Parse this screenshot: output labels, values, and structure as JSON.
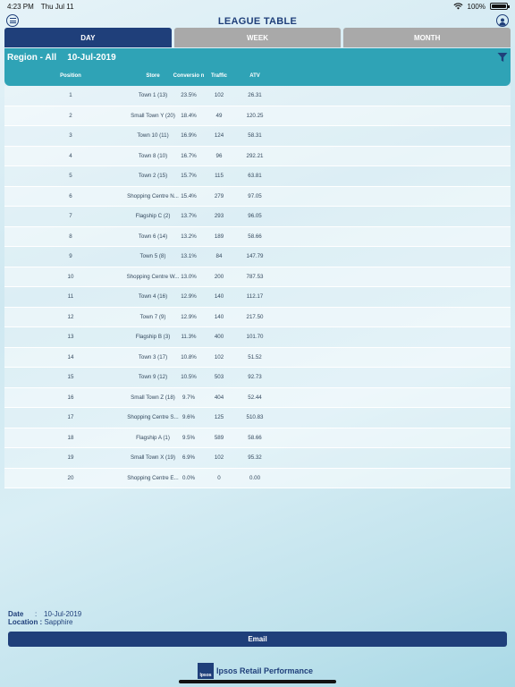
{
  "status_bar": {
    "time": "4:23 PM",
    "date": "Thu Jul 11",
    "battery": "100%",
    "battery_level": 1.0
  },
  "header": {
    "title": "LEAGUE TABLE"
  },
  "tabs": [
    {
      "label": "DAY",
      "active": true
    },
    {
      "label": "WEEK",
      "active": false
    },
    {
      "label": "MONTH",
      "active": false
    }
  ],
  "filter": {
    "region": "Region - All",
    "date": "10-Jul-2019"
  },
  "table": {
    "headers": {
      "position": "Position",
      "store": "Store",
      "conversion": "Conversio n",
      "traffic": "Traffic",
      "atv": "ATV"
    },
    "rows": [
      {
        "position": "1",
        "store": "Town 1 (13)",
        "conversion": "23.5%",
        "traffic": "102",
        "atv": "26.31"
      },
      {
        "position": "2",
        "store": "Small Town Y (20)",
        "conversion": "18.4%",
        "traffic": "49",
        "atv": "120.25"
      },
      {
        "position": "3",
        "store": "Town 10 (11)",
        "conversion": "16.9%",
        "traffic": "124",
        "atv": "58.31"
      },
      {
        "position": "4",
        "store": "Town 8 (10)",
        "conversion": "16.7%",
        "traffic": "96",
        "atv": "292.21"
      },
      {
        "position": "5",
        "store": "Town 2 (15)",
        "conversion": "15.7%",
        "traffic": "115",
        "atv": "63.81"
      },
      {
        "position": "6",
        "store": "Shopping Centre N...",
        "conversion": "15.4%",
        "traffic": "279",
        "atv": "97.05"
      },
      {
        "position": "7",
        "store": "Flagship C (2)",
        "conversion": "13.7%",
        "traffic": "293",
        "atv": "96.05"
      },
      {
        "position": "8",
        "store": "Town 6 (14)",
        "conversion": "13.2%",
        "traffic": "189",
        "atv": "58.66"
      },
      {
        "position": "9",
        "store": "Town 5 (8)",
        "conversion": "13.1%",
        "traffic": "84",
        "atv": "147.79"
      },
      {
        "position": "10",
        "store": "Shopping Centre W...",
        "conversion": "13.0%",
        "traffic": "200",
        "atv": "787.53"
      },
      {
        "position": "11",
        "store": "Town 4 (16)",
        "conversion": "12.9%",
        "traffic": "140",
        "atv": "112.17"
      },
      {
        "position": "12",
        "store": "Town 7 (9)",
        "conversion": "12.9%",
        "traffic": "140",
        "atv": "217.50"
      },
      {
        "position": "13",
        "store": "Flagship B (3)",
        "conversion": "11.3%",
        "traffic": "400",
        "atv": "101.70"
      },
      {
        "position": "14",
        "store": "Town 3 (17)",
        "conversion": "10.8%",
        "traffic": "102",
        "atv": "51.52"
      },
      {
        "position": "15",
        "store": "Town 9 (12)",
        "conversion": "10.5%",
        "traffic": "503",
        "atv": "92.73"
      },
      {
        "position": "16",
        "store": "Small Town Z (18)",
        "conversion": "9.7%",
        "traffic": "404",
        "atv": "52.44"
      },
      {
        "position": "17",
        "store": "Shopping Centre S...",
        "conversion": "9.6%",
        "traffic": "125",
        "atv": "510.83"
      },
      {
        "position": "18",
        "store": "Flagship A (1)",
        "conversion": "9.5%",
        "traffic": "589",
        "atv": "58.66"
      },
      {
        "position": "19",
        "store": "Small Town X (19)",
        "conversion": "6.9%",
        "traffic": "102",
        "atv": "95.32"
      },
      {
        "position": "20",
        "store": "Shopping Centre E...",
        "conversion": "0.0%",
        "traffic": "0",
        "atv": "0.00"
      }
    ]
  },
  "footer": {
    "date_label": "Date",
    "date_sep": ":",
    "date_value": "10-Jul-2019",
    "location_label": "Location :",
    "location_value": "Sapphire",
    "email_label": "Email",
    "brand_logo": "Ipsos",
    "brand_text": "Ipsos Retail Performance"
  },
  "colors": {
    "primary": "#1f3f7a",
    "accent": "#2fa3b6",
    "inactive_tab": "#a9a9a9"
  }
}
